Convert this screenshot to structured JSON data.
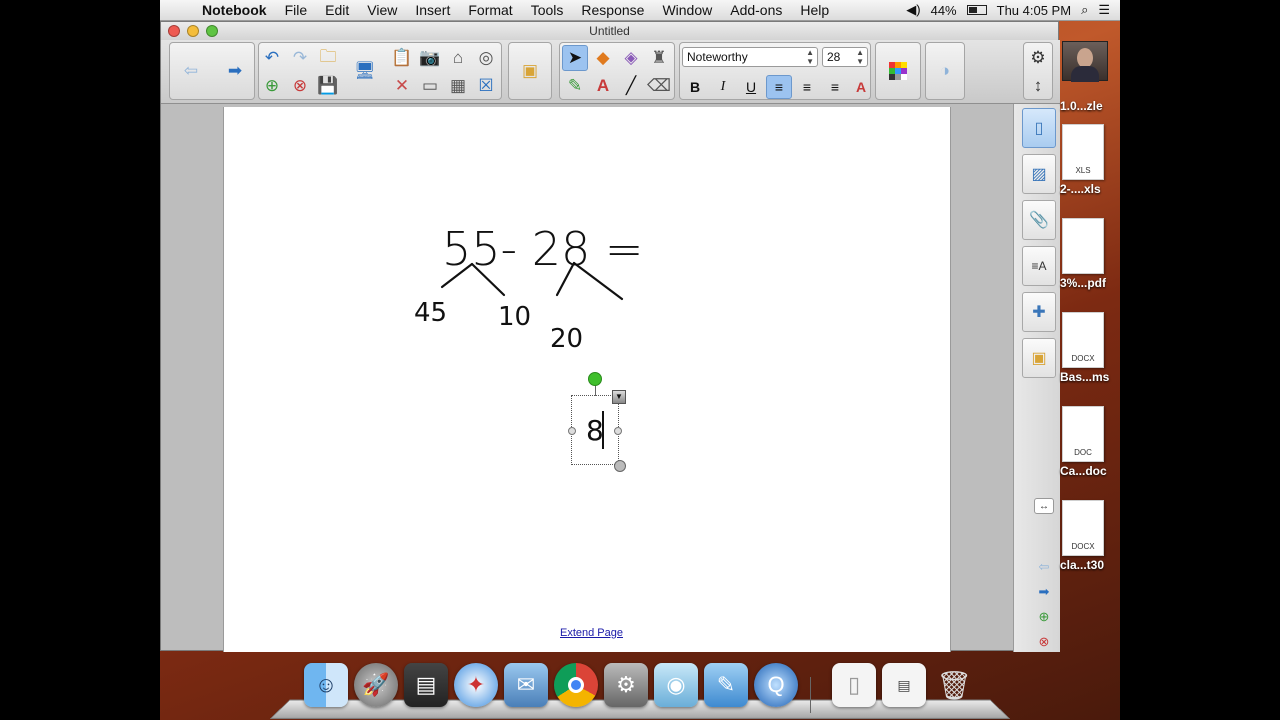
{
  "menubar": {
    "app_name": "Notebook",
    "items": [
      "File",
      "Edit",
      "View",
      "Insert",
      "Format",
      "Tools",
      "Response",
      "Window",
      "Add-ons",
      "Help"
    ],
    "battery": "44%",
    "clock": "Thu 4:05 PM"
  },
  "window": {
    "title": "Untitled"
  },
  "toolbar": {
    "font_name": "Noteworthy",
    "font_size": "28",
    "bold_label": "B",
    "italic_label": "I",
    "underline_label": "U"
  },
  "canvas": {
    "expression": "55- 28 =",
    "n1": "45",
    "n2": "10",
    "n3": "20",
    "textbox_value": "8",
    "extend_page_link": "Extend Page"
  },
  "desktop_icons": [
    {
      "label": "1.0...zle"
    },
    {
      "label": "2-....xls",
      "badge": "XLS"
    },
    {
      "label": "3%...pdf"
    },
    {
      "label": "Bas...ms",
      "badge": "DOCX"
    },
    {
      "label": "Ca...doc",
      "badge": "DOC"
    },
    {
      "label": "cla...t30",
      "badge": "DOCX"
    }
  ],
  "colors": {
    "accent": "#2a6fbf",
    "link": "#1a1aa8",
    "rotate_handle": "#3fbf2c"
  }
}
